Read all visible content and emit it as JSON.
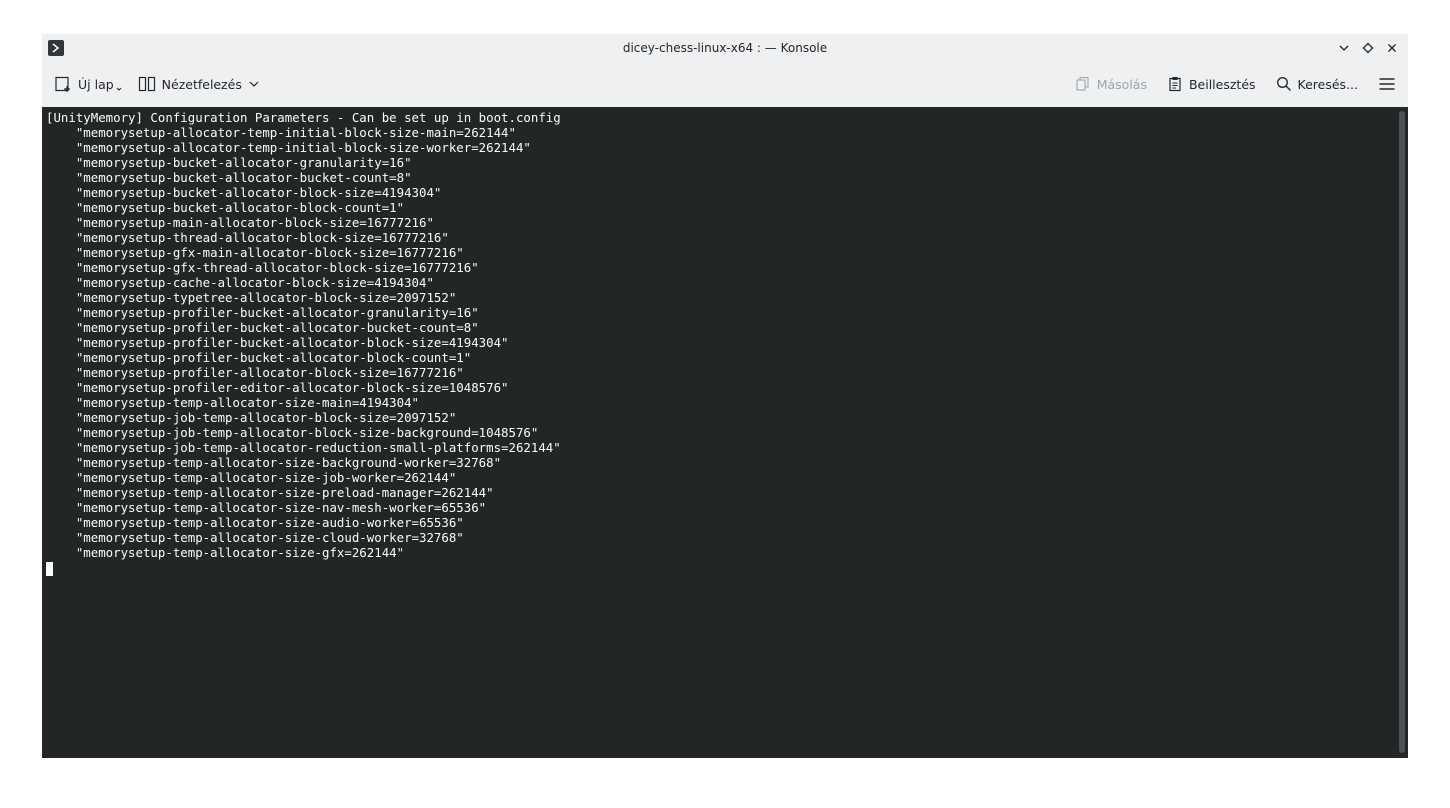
{
  "window": {
    "title": "dicey-chess-linux-x64 : — Konsole"
  },
  "toolbar": {
    "new_tab_label": "Új lap",
    "split_view_label": "Nézetfelezés",
    "copy_label": "Másolás",
    "paste_label": "Beillesztés",
    "find_label": "Keresés..."
  },
  "terminal": {
    "lines": [
      "[UnityMemory] Configuration Parameters - Can be set up in boot.config",
      "    \"memorysetup-allocator-temp-initial-block-size-main=262144\"",
      "    \"memorysetup-allocator-temp-initial-block-size-worker=262144\"",
      "    \"memorysetup-bucket-allocator-granularity=16\"",
      "    \"memorysetup-bucket-allocator-bucket-count=8\"",
      "    \"memorysetup-bucket-allocator-block-size=4194304\"",
      "    \"memorysetup-bucket-allocator-block-count=1\"",
      "    \"memorysetup-main-allocator-block-size=16777216\"",
      "    \"memorysetup-thread-allocator-block-size=16777216\"",
      "    \"memorysetup-gfx-main-allocator-block-size=16777216\"",
      "    \"memorysetup-gfx-thread-allocator-block-size=16777216\"",
      "    \"memorysetup-cache-allocator-block-size=4194304\"",
      "    \"memorysetup-typetree-allocator-block-size=2097152\"",
      "    \"memorysetup-profiler-bucket-allocator-granularity=16\"",
      "    \"memorysetup-profiler-bucket-allocator-bucket-count=8\"",
      "    \"memorysetup-profiler-bucket-allocator-block-size=4194304\"",
      "    \"memorysetup-profiler-bucket-allocator-block-count=1\"",
      "    \"memorysetup-profiler-allocator-block-size=16777216\"",
      "    \"memorysetup-profiler-editor-allocator-block-size=1048576\"",
      "    \"memorysetup-temp-allocator-size-main=4194304\"",
      "    \"memorysetup-job-temp-allocator-block-size=2097152\"",
      "    \"memorysetup-job-temp-allocator-block-size-background=1048576\"",
      "    \"memorysetup-job-temp-allocator-reduction-small-platforms=262144\"",
      "    \"memorysetup-temp-allocator-size-background-worker=32768\"",
      "    \"memorysetup-temp-allocator-size-job-worker=262144\"",
      "    \"memorysetup-temp-allocator-size-preload-manager=262144\"",
      "    \"memorysetup-temp-allocator-size-nav-mesh-worker=65536\"",
      "    \"memorysetup-temp-allocator-size-audio-worker=65536\"",
      "    \"memorysetup-temp-allocator-size-cloud-worker=32768\"",
      "    \"memorysetup-temp-allocator-size-gfx=262144\""
    ]
  },
  "icons": {
    "app": "konsole-prompt-icon",
    "new_tab": "new-tab-icon",
    "split_view": "split-view-icon",
    "copy": "copy-icon",
    "paste": "paste-icon",
    "find": "search-icon",
    "menu": "hamburger-menu-icon",
    "minimize": "chevron-down-icon",
    "maximize": "diamond-icon",
    "close": "close-icon"
  },
  "colors": {
    "terminal_bg": "#232627",
    "terminal_fg": "#fcfcfc",
    "chrome_bg": "#eff0f1"
  }
}
